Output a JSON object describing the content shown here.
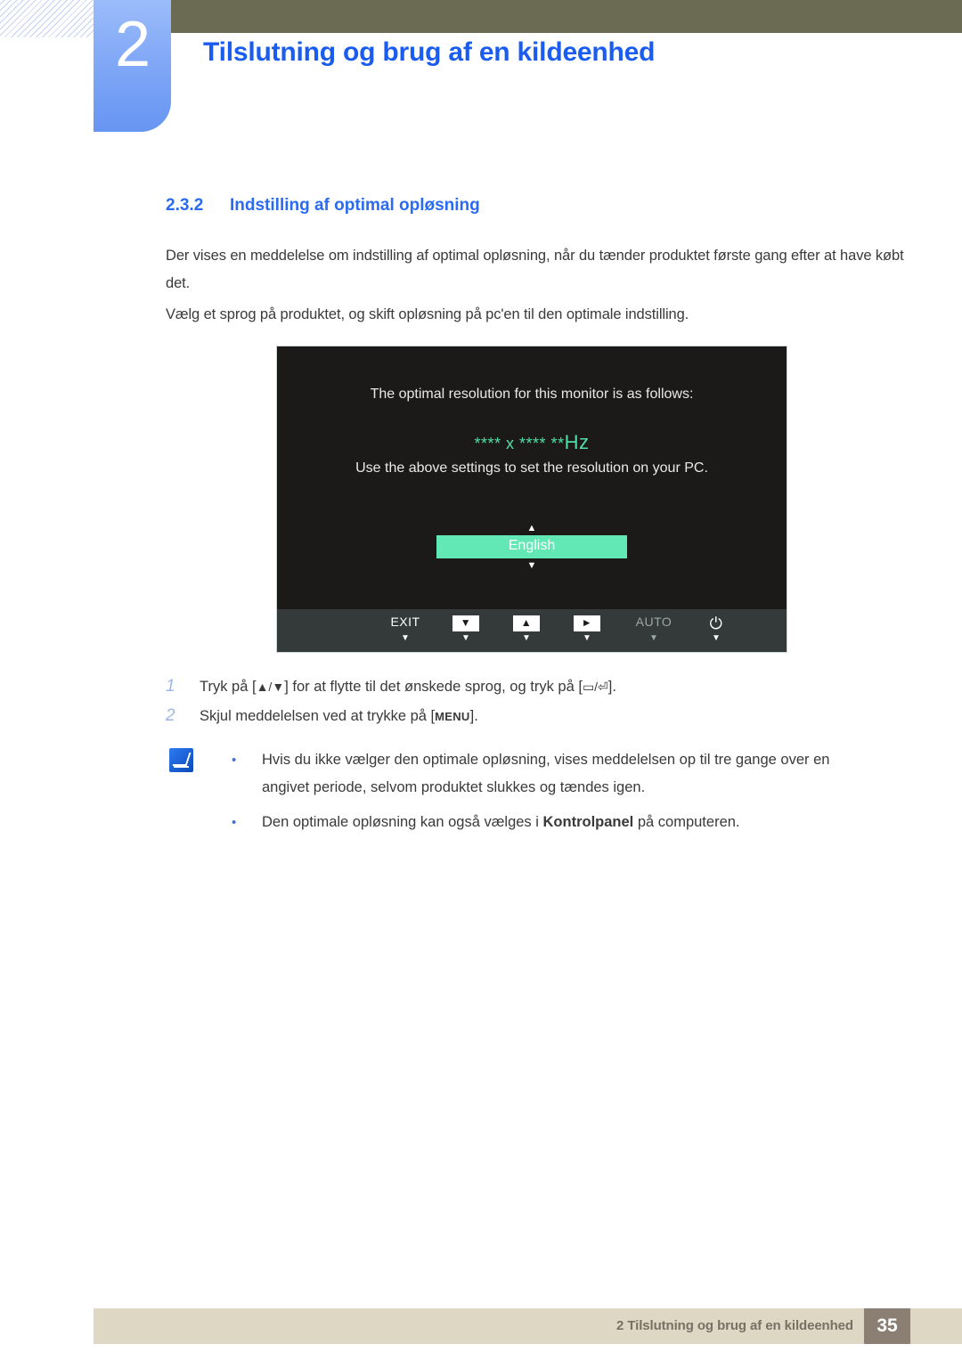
{
  "header": {
    "chapter_number": "2",
    "chapter_title": "Tilslutning og brug af en kildeenhed"
  },
  "section": {
    "number": "2.3.2",
    "title": "Indstilling af optimal opløsning",
    "paragraph_1": "Der vises en meddelelse om indstilling af optimal opløsning, når du tænder produktet første gang efter at have købt det.",
    "paragraph_2": "Vælg et sprog på produktet, og skift opløsning på pc'en til den optimale indstilling."
  },
  "osd": {
    "line_1": "The optimal resolution for this monitor is as follows:",
    "resolution": "**** x **** **",
    "resolution_unit": "Hz",
    "line_2": "Use the above settings to set the resolution on your PC.",
    "selected_language": "English",
    "caret_up": "▲",
    "caret_down": "▼",
    "accent_color": "#61e8b4",
    "resolution_color": "#4fe0a5",
    "background_color": "#1b1a19",
    "buttonbar_color": "#343a3a",
    "buttons": [
      {
        "label": "EXIT",
        "type": "text",
        "tick": "▼",
        "dim": false
      },
      {
        "label": "▼",
        "type": "box",
        "tick": "▼",
        "dim": false
      },
      {
        "label": "▲",
        "type": "box",
        "tick": "▼",
        "dim": false
      },
      {
        "label": "►",
        "type": "box",
        "tick": "▼",
        "dim": false
      },
      {
        "label": "AUTO",
        "type": "text",
        "tick": "▼",
        "dim": true
      },
      {
        "label": "⏻",
        "type": "glyph",
        "tick": "▼",
        "dim": false
      }
    ]
  },
  "steps": [
    {
      "number": "1",
      "text_before": "Tryk på [",
      "keys_1": "▲/▼",
      "text_middle": "] for at flytte til det ønskede sprog, og tryk på [",
      "keys_2": "▭/⏎",
      "text_after": "]."
    },
    {
      "number": "2",
      "text_before": "Skjul meddelelsen ved at trykke på [",
      "keys_1": "MENU",
      "text_after": "]."
    }
  ],
  "note": {
    "icon": "note-pen-icon",
    "items": [
      "Hvis du ikke vælger den optimale opløsning, vises meddelelsen op til tre gange over en angivet periode, selvom produktet slukkes og tændes igen.",
      "Den optimale opløsning kan også vælges i Kontrolpanel på computeren."
    ],
    "item_2_before": "Den optimale opløsning kan også vælges i ",
    "item_2_bold": "Kontrolpanel",
    "item_2_after": " på computeren.",
    "bullet": "•"
  },
  "footer": {
    "text": "2 Tilslutning og brug af en kildeenhed",
    "page": "35"
  }
}
